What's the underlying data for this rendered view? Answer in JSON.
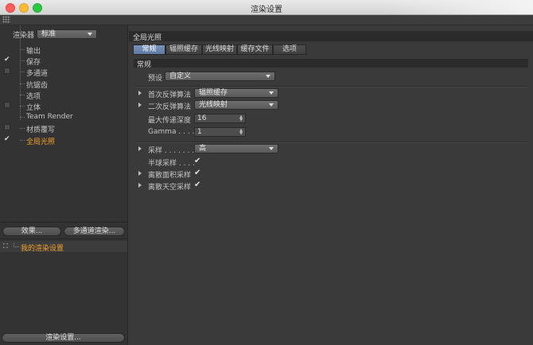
{
  "window": {
    "title": "渲染设置"
  },
  "sidebar": {
    "renderer_label": "渲染器",
    "renderer_value": "标准",
    "items": [
      {
        "label": "输出",
        "check": ""
      },
      {
        "label": "保存",
        "check": "✔"
      },
      {
        "label": "多通道",
        "check": "box"
      },
      {
        "label": "抗锯齿",
        "check": ""
      },
      {
        "label": "选项",
        "check": ""
      },
      {
        "label": "立体",
        "check": "box"
      },
      {
        "label": "Team Render",
        "check": ""
      },
      {
        "label": "材质覆写",
        "check": "box"
      },
      {
        "label": "全局光照",
        "check": "✔",
        "active": true
      }
    ],
    "effect_button": "效果...",
    "multipass_button": "多通道渲染...",
    "setting_name": "我的渲染设置",
    "render_settings_button": "渲染设置..."
  },
  "panel": {
    "title": "全局光照",
    "tabs": [
      "常规",
      "辐照缓存",
      "光线映射",
      "缓存文件",
      "选项"
    ],
    "active_tab": 0,
    "section": "常规",
    "preset_label": "预设",
    "preset_value": "自定义",
    "primary_label": "首次反弹算法",
    "primary_value": "辐照缓存",
    "secondary_label": "二次反弹算法",
    "secondary_value": "光线映射",
    "max_depth_label": "最大传递深度",
    "max_depth_value": "16",
    "gamma_label": "Gamma . . . .",
    "gamma_value": "1",
    "sampling_label": "采样 . . . . . . .",
    "sampling_value": "高",
    "hemi_label": "半球采样 . . . .",
    "hemi_checked": "✔",
    "area_label": "离散面积采样",
    "area_checked": "✔",
    "sky_label": "离散天空采样",
    "sky_checked": "✔"
  },
  "colors": {
    "accent_orange": "#f0a02a",
    "tab_active": "#6a86ae"
  }
}
